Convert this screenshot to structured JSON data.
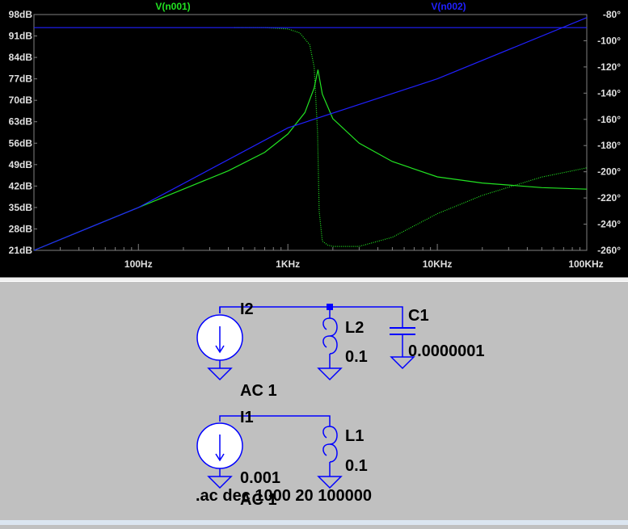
{
  "plot": {
    "colors": {
      "background": "#000000",
      "frame": "#808080",
      "axis_text": "#e0e0e0",
      "trace1": "#22e322",
      "trace2": "#2020ff"
    },
    "legend": {
      "trace1": "V(n001)",
      "trace2": "V(n002)"
    },
    "left_axis": {
      "ticks": [
        "98dB",
        "91dB",
        "84dB",
        "77dB",
        "70dB",
        "63dB",
        "56dB",
        "49dB",
        "42dB",
        "35dB",
        "28dB",
        "21dB"
      ]
    },
    "right_axis": {
      "ticks": [
        "-80°",
        "-100°",
        "-120°",
        "-140°",
        "-160°",
        "-180°",
        "-200°",
        "-220°",
        "-240°",
        "-260°"
      ]
    },
    "x_axis": {
      "ticks": [
        "100Hz",
        "1KHz",
        "10KHz",
        "100KHz"
      ]
    }
  },
  "chart_data": {
    "type": "line",
    "x_scale": "log",
    "xlim": [
      20,
      100000
    ],
    "left_ylim": [
      21,
      98
    ],
    "right_ylim": [
      -260,
      -80
    ],
    "grid": false,
    "series": [
      {
        "name": "V(n001)",
        "axis": "left",
        "x": [
          20,
          50,
          100,
          200,
          400,
          700,
          1000,
          1300,
          1500,
          1590,
          1700,
          2000,
          3000,
          5000,
          10000,
          20000,
          50000,
          100000
        ],
        "y": [
          21,
          29,
          35,
          41,
          47,
          53,
          59,
          66,
          74,
          80,
          72,
          64,
          56,
          50,
          45,
          43,
          41.5,
          41
        ]
      },
      {
        "name": "V(n001) phase",
        "axis": "right",
        "x": [
          440,
          700,
          1000,
          1200,
          1400,
          1500,
          1580,
          1620,
          1700,
          1850,
          2000,
          3000,
          5000,
          10000,
          20000,
          50000,
          100000
        ],
        "y": [
          -90,
          -90,
          -91,
          -94,
          -103,
          -120,
          -170,
          -230,
          -253,
          -256,
          -257,
          -257,
          -250,
          -232,
          -218,
          -204,
          -197
        ]
      },
      {
        "name": "V(n002)",
        "axis": "left",
        "x": [
          20,
          100,
          1000,
          10000,
          100000
        ],
        "y": [
          21,
          35,
          61,
          77,
          97
        ]
      },
      {
        "name": "V(n002) phase",
        "axis": "right",
        "x": [
          20,
          100000
        ],
        "y": [
          -90,
          -90
        ]
      }
    ]
  },
  "schematic": {
    "colors": {
      "wire": "#0000ff",
      "component": "#0000ff",
      "component_fill": "#ffffff",
      "junction": "#0000ff",
      "text": "#000000"
    },
    "components": {
      "i2": {
        "name": "I2",
        "value": "AC 1"
      },
      "l2": {
        "name": "L2",
        "value": "0.1"
      },
      "c1": {
        "name": "C1",
        "value": "0.0000001"
      },
      "i1": {
        "name": "I1",
        "value": "0.001",
        "value2": "AC 1"
      },
      "l1": {
        "name": "L1",
        "value": "0.1"
      }
    },
    "directive": ".ac dec 1000 20 100000"
  }
}
